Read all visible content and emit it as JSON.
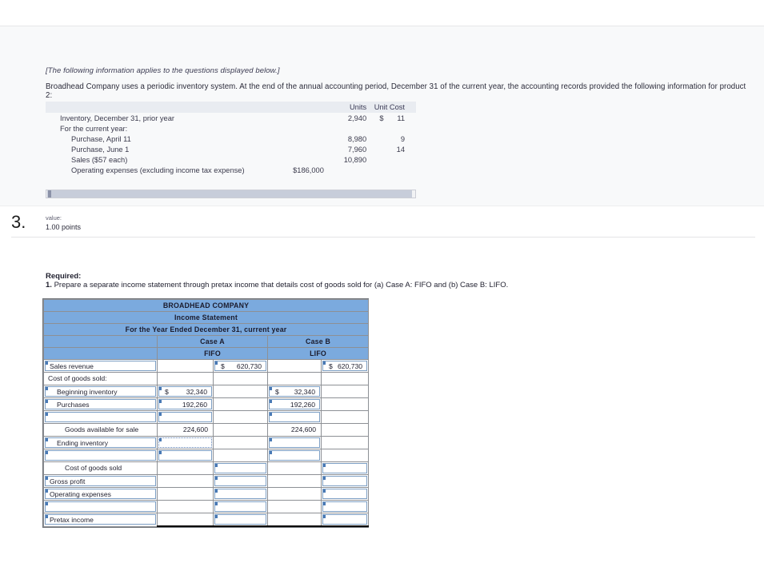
{
  "info_panel": {
    "note": "[The following information applies to the questions displayed below.]",
    "intro": "Broadhead Company uses a periodic inventory system. At the end of the annual accounting period, December 31 of the current year, the accounting records provided the following information for product 2:",
    "table": {
      "headers": {
        "blank": "",
        "mid": "",
        "units": "Units",
        "unit_cost": "Unit Cost"
      },
      "rows": [
        {
          "label": "Inventory, December 31, prior year",
          "indent": 0,
          "mid": "",
          "units": "2,940",
          "cost_symbol": "$",
          "cost": "11"
        },
        {
          "label": "For the current year:",
          "indent": 0,
          "mid": "",
          "units": "",
          "cost_symbol": "",
          "cost": ""
        },
        {
          "label": "Purchase, April 11",
          "indent": 1,
          "mid": "",
          "units": "8,980",
          "cost_symbol": "",
          "cost": "9"
        },
        {
          "label": "Purchase, June 1",
          "indent": 1,
          "mid": "",
          "units": "7,960",
          "cost_symbol": "",
          "cost": "14"
        },
        {
          "label": "Sales ($57 each)",
          "indent": 1,
          "mid": "",
          "units": "10,890",
          "cost_symbol": "",
          "cost": ""
        },
        {
          "label": "Operating expenses (excluding income tax expense)",
          "indent": 1,
          "mid": "$186,000",
          "units": "",
          "cost_symbol": "",
          "cost": ""
        }
      ]
    },
    "scrollbar": "horizontal-scrollbar"
  },
  "question": {
    "number": "3.",
    "value_label": "value:",
    "points": "1.00 points"
  },
  "required": {
    "title": "Required:",
    "item_number": "1.",
    "text": "Prepare a separate income statement through pretax income that details cost of goods sold for (a) Case A: FIFO and (b) Case B: LIFO."
  },
  "income_statement": {
    "title1": "BROADHEAD COMPANY",
    "title2": "Income Statement",
    "title3": "For the Year Ended December 31, current year",
    "case_a": "Case A",
    "case_b": "Case B",
    "method_a": "FIFO",
    "method_b": "LIFO",
    "rows": [
      {
        "label": "Sales revenue",
        "indent": 0,
        "label_box": true,
        "ruled": false,
        "dblbot": false,
        "a1": {
          "box": false,
          "dollar": "",
          "value": ""
        },
        "a2": {
          "box": true,
          "dollar": "$",
          "value": "620,730"
        },
        "b1": {
          "box": false,
          "dollar": "",
          "value": ""
        },
        "b2": {
          "box": true,
          "dollar": "$",
          "value": "620,730"
        }
      },
      {
        "label": "Cost of goods sold:",
        "indent": 0,
        "label_box": false,
        "ruled": false,
        "dblbot": false,
        "a1": {
          "box": false,
          "dollar": "",
          "value": ""
        },
        "a2": {
          "box": false,
          "dollar": "",
          "value": ""
        },
        "b1": {
          "box": false,
          "dollar": "",
          "value": ""
        },
        "b2": {
          "box": false,
          "dollar": "",
          "value": ""
        }
      },
      {
        "label": "Beginning inventory",
        "indent": 1,
        "label_box": true,
        "ruled": false,
        "dblbot": false,
        "a1": {
          "box": true,
          "dollar": "$",
          "value": "32,340"
        },
        "a2": {
          "box": false,
          "dollar": "",
          "value": ""
        },
        "b1": {
          "box": true,
          "dollar": "$",
          "value": "32,340"
        },
        "b2": {
          "box": false,
          "dollar": "",
          "value": ""
        }
      },
      {
        "label": "Purchases",
        "indent": 1,
        "label_box": true,
        "ruled": false,
        "dblbot": false,
        "a1": {
          "box": true,
          "dollar": "",
          "value": "192,260"
        },
        "a2": {
          "box": false,
          "dollar": "",
          "value": ""
        },
        "b1": {
          "box": true,
          "dollar": "",
          "value": "192,260"
        },
        "b2": {
          "box": false,
          "dollar": "",
          "value": ""
        }
      },
      {
        "label": "",
        "indent": 1,
        "label_box": true,
        "ruled": false,
        "dblbot": false,
        "a1": {
          "box": true,
          "dollar": "",
          "value": ""
        },
        "a2": {
          "box": false,
          "dollar": "",
          "value": ""
        },
        "b1": {
          "box": true,
          "dollar": "",
          "value": ""
        },
        "b2": {
          "box": false,
          "dollar": "",
          "value": ""
        }
      },
      {
        "label": "Goods available for sale",
        "indent": 2,
        "label_box": false,
        "ruled": true,
        "dblbot": false,
        "a1": {
          "box": false,
          "dollar": "",
          "value": "224,600"
        },
        "a2": {
          "box": false,
          "dollar": "",
          "value": ""
        },
        "b1": {
          "box": false,
          "dollar": "",
          "value": "224,600"
        },
        "b2": {
          "box": false,
          "dollar": "",
          "value": ""
        }
      },
      {
        "label": "Ending inventory",
        "indent": 1,
        "label_box": true,
        "ruled": false,
        "dblbot": false,
        "a1": {
          "box": true,
          "dotted": true,
          "dollar": "",
          "value": ""
        },
        "a2": {
          "box": false,
          "dollar": "",
          "value": ""
        },
        "b1": {
          "box": true,
          "dollar": "",
          "value": ""
        },
        "b2": {
          "box": false,
          "dollar": "",
          "value": ""
        }
      },
      {
        "label": "",
        "indent": 1,
        "label_box": true,
        "ruled": false,
        "dblbot": false,
        "a1": {
          "box": true,
          "dollar": "",
          "value": ""
        },
        "a2": {
          "box": false,
          "dollar": "",
          "value": ""
        },
        "b1": {
          "box": true,
          "dollar": "",
          "value": ""
        },
        "b2": {
          "box": false,
          "dollar": "",
          "value": ""
        }
      },
      {
        "label": "Cost of goods sold",
        "indent": 2,
        "label_box": false,
        "ruled": true,
        "dblbot": false,
        "a1": {
          "box": false,
          "dollar": "",
          "value": ""
        },
        "a2": {
          "box": true,
          "dollar": "",
          "value": ""
        },
        "b1": {
          "box": false,
          "dollar": "",
          "value": ""
        },
        "b2": {
          "box": true,
          "dollar": "",
          "value": ""
        }
      },
      {
        "label": "Gross profit",
        "indent": 0,
        "label_box": true,
        "ruled": false,
        "dblbot": false,
        "a1": {
          "box": false,
          "dollar": "",
          "value": ""
        },
        "a2": {
          "box": true,
          "ruled": true,
          "dollar": "",
          "value": ""
        },
        "b1": {
          "box": false,
          "dollar": "",
          "value": ""
        },
        "b2": {
          "box": true,
          "ruled": true,
          "dollar": "",
          "value": ""
        }
      },
      {
        "label": "Operating expenses",
        "indent": 0,
        "label_box": true,
        "ruled": false,
        "dblbot": false,
        "a1": {
          "box": false,
          "dollar": "",
          "value": ""
        },
        "a2": {
          "box": true,
          "dollar": "",
          "value": ""
        },
        "b1": {
          "box": false,
          "dollar": "",
          "value": ""
        },
        "b2": {
          "box": true,
          "dollar": "",
          "value": ""
        }
      },
      {
        "label": "",
        "indent": 0,
        "label_box": true,
        "ruled": false,
        "dblbot": false,
        "a1": {
          "box": false,
          "dollar": "",
          "value": ""
        },
        "a2": {
          "box": true,
          "dollar": "",
          "value": ""
        },
        "b1": {
          "box": false,
          "dollar": "",
          "value": ""
        },
        "b2": {
          "box": true,
          "dollar": "",
          "value": ""
        }
      },
      {
        "label": "Pretax income",
        "indent": 0,
        "label_box": true,
        "ruled": false,
        "dblbot": true,
        "a1": {
          "box": false,
          "dollar": "",
          "value": ""
        },
        "a2": {
          "box": true,
          "ruled": true,
          "dollar": "",
          "value": ""
        },
        "b1": {
          "box": false,
          "dollar": "",
          "value": ""
        },
        "b2": {
          "box": true,
          "ruled": true,
          "dollar": "",
          "value": ""
        }
      }
    ]
  }
}
